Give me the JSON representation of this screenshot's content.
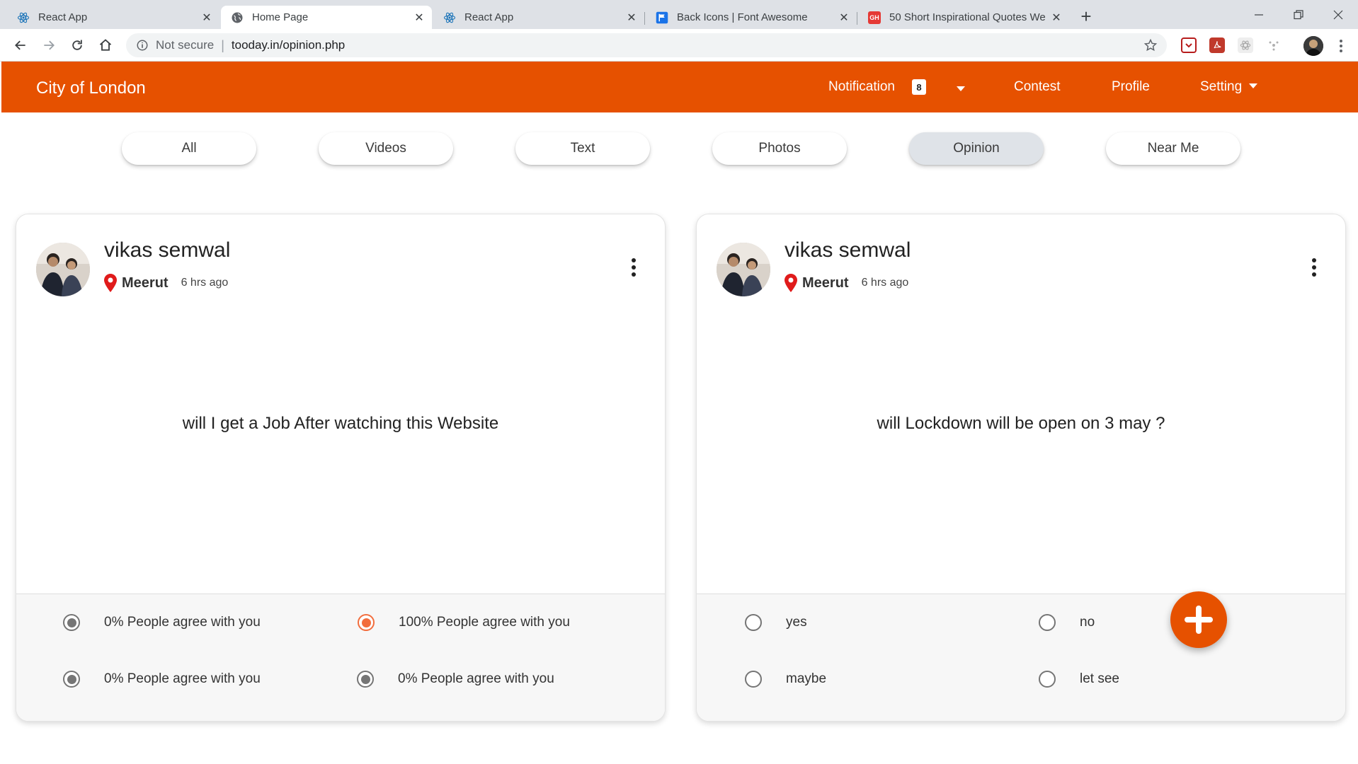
{
  "browser": {
    "tabs": [
      {
        "title": "React App",
        "icon": "react-icon"
      },
      {
        "title": "Home Page",
        "icon": "globe-icon"
      },
      {
        "title": "React App",
        "icon": "react-icon"
      },
      {
        "title": "Back Icons | Font Awesome",
        "icon": "flag-icon"
      },
      {
        "title": "50 Short Inspirational Quotes We",
        "icon": "gh-icon",
        "icon_text": "GH"
      }
    ],
    "active_tab_index": 1,
    "address": {
      "security_label": "Not secure",
      "url": "tooday.in/opinion.php"
    }
  },
  "app": {
    "brand": "City of London",
    "accent_color": "#e65100",
    "nav": {
      "notification_label": "Notification",
      "notification_count": "8",
      "contest_label": "Contest",
      "profile_label": "Profile",
      "setting_label": "Setting"
    },
    "filters": [
      "All",
      "Videos",
      "Text",
      "Photos",
      "Opinion",
      "Near Me"
    ],
    "active_filter": "Opinion"
  },
  "posts": [
    {
      "author": "vikas semwal",
      "location": "Meerut",
      "time": "6 hrs ago",
      "question": "will I get a Job After watching this Website",
      "options": [
        {
          "label": "0% People agree with you",
          "state": "filled"
        },
        {
          "label": "100% People agree with you",
          "state": "voted"
        },
        {
          "label": "0% People agree with you",
          "state": "filled"
        },
        {
          "label": "0% People agree with you",
          "state": "filled"
        }
      ]
    },
    {
      "author": "vikas semwal",
      "location": "Meerut",
      "time": "6 hrs ago",
      "question": "will Lockdown will be open on 3 may ?",
      "options": [
        {
          "label": "yes",
          "state": "empty"
        },
        {
          "label": "no",
          "state": "empty"
        },
        {
          "label": "maybe",
          "state": "empty"
        },
        {
          "label": "let see",
          "state": "empty"
        }
      ]
    }
  ]
}
